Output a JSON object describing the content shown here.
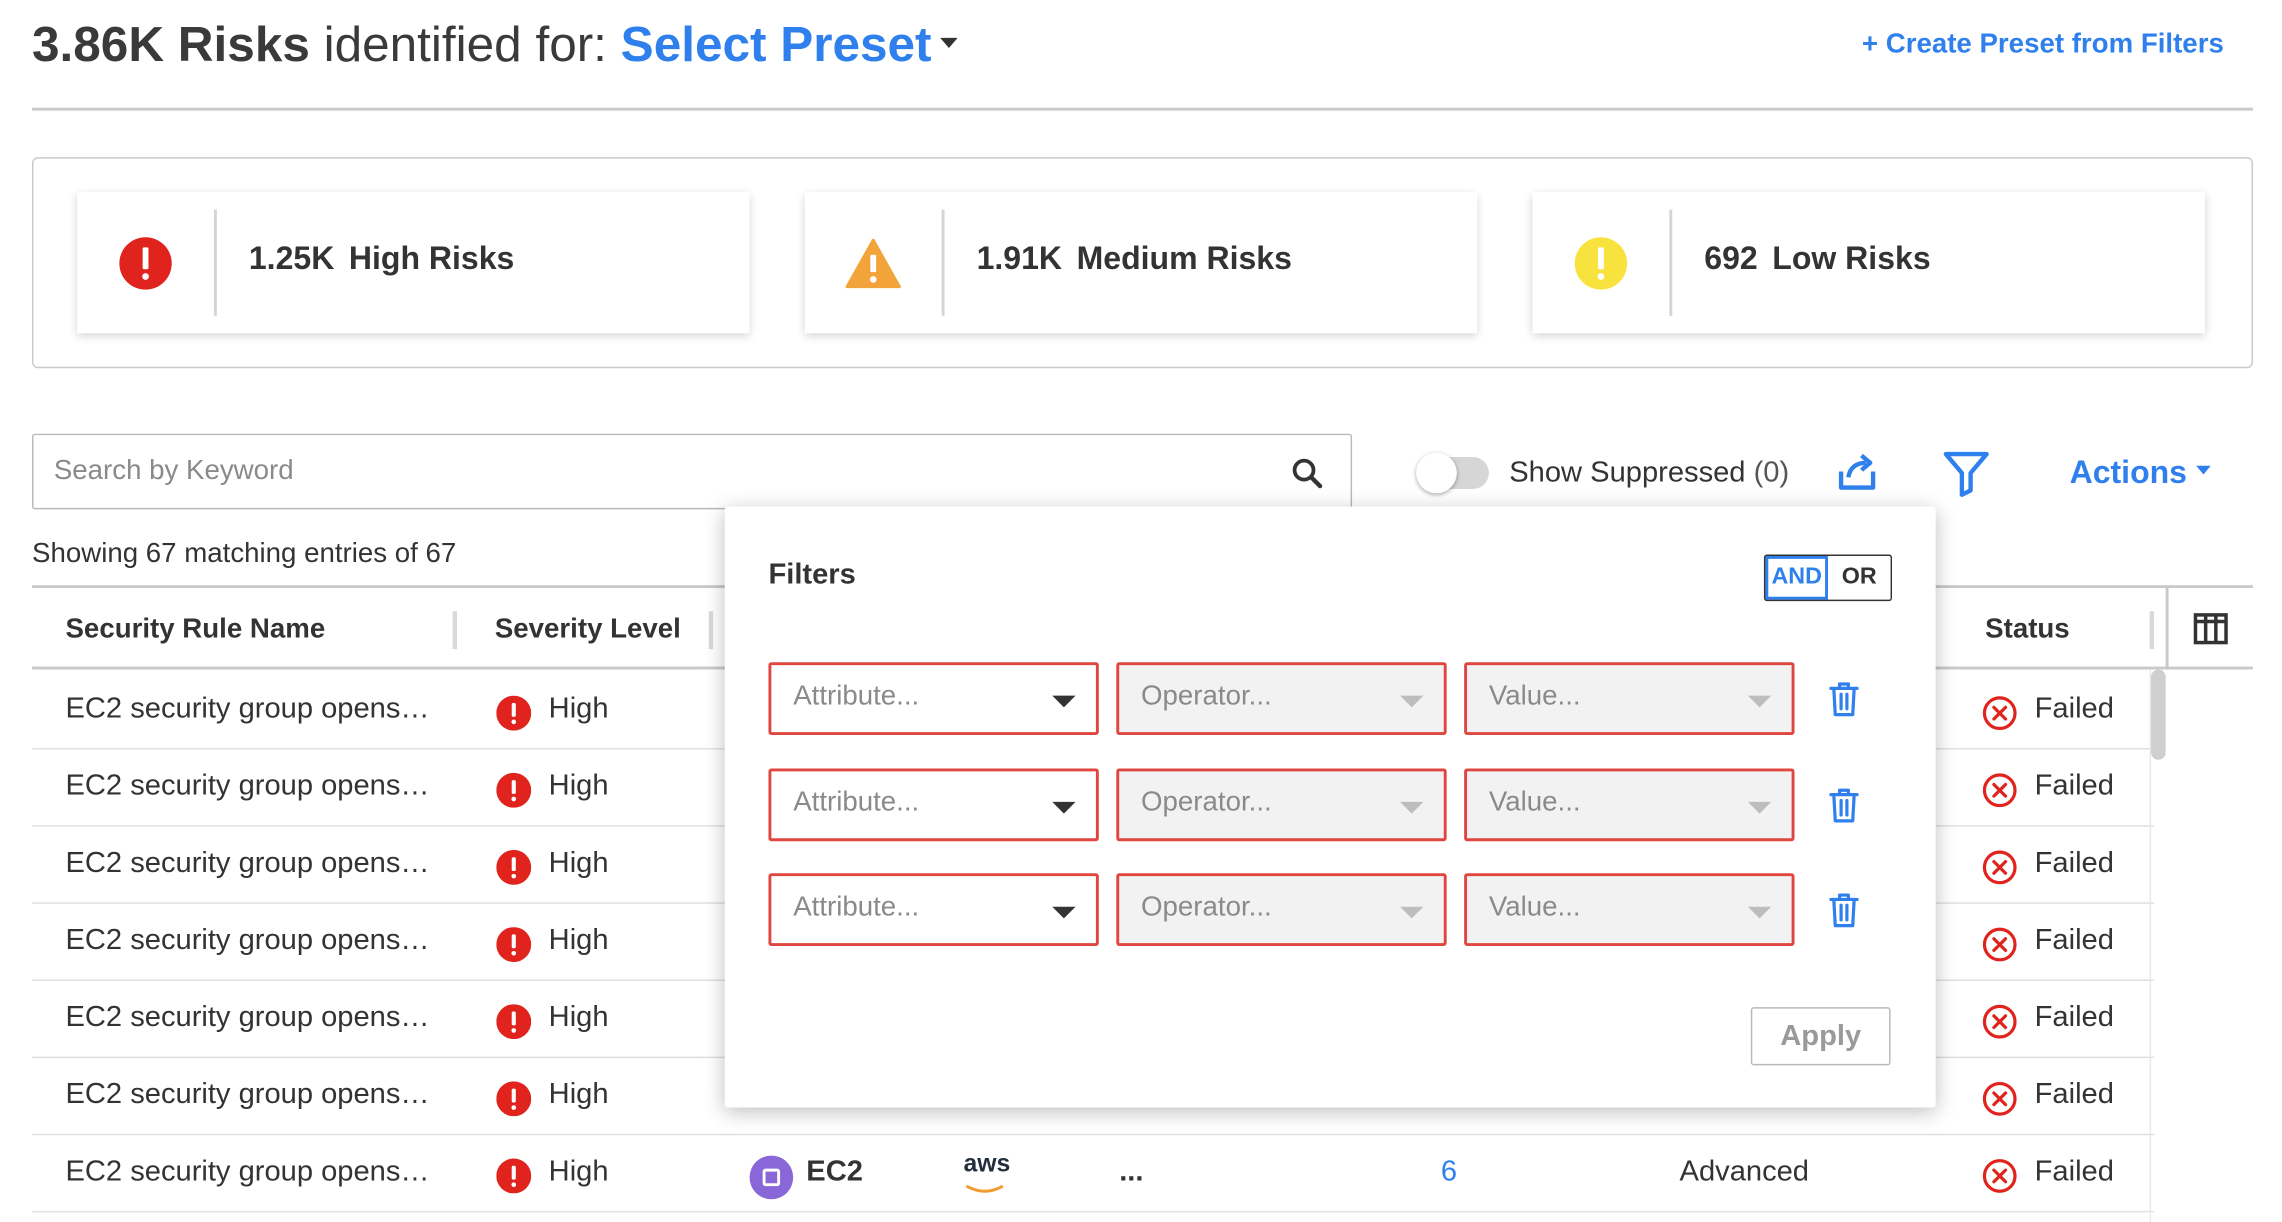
{
  "header": {
    "count": "3.86K Risks",
    "identified_text": " identified for: ",
    "preset_label": "Select Preset",
    "create_preset": "+ Create Preset from Filters"
  },
  "summary": {
    "high": {
      "count": "1.25K",
      "label": "High Risks",
      "color": "#e0231c"
    },
    "medium": {
      "count": "1.91K",
      "label": "Medium Risks",
      "color": "#f2a33a"
    },
    "low": {
      "count": "692",
      "label": "Low Risks",
      "color": "#f8e33e"
    }
  },
  "search": {
    "placeholder": "Search by Keyword",
    "icon": "search-icon"
  },
  "toolbar": {
    "suppressed_label": "Show Suppressed",
    "suppressed_count": "(0)",
    "share_icon": "share-icon",
    "filter_icon": "filter-icon",
    "actions_label": "Actions"
  },
  "showing_text": "Showing 67 matching entries of 67",
  "table": {
    "columns": [
      "Security Rule Name",
      "Severity Level",
      "Status"
    ],
    "rows": [
      {
        "name": "EC2 security group opens…",
        "severity": "High",
        "status": "Failed"
      },
      {
        "name": "EC2 security group opens…",
        "severity": "High",
        "status": "Failed"
      },
      {
        "name": "EC2 security group opens…",
        "severity": "High",
        "status": "Failed"
      },
      {
        "name": "EC2 security group opens…",
        "severity": "High",
        "status": "Failed"
      },
      {
        "name": "EC2 security group opens…",
        "severity": "High",
        "status": "Failed"
      },
      {
        "name": "EC2 security group opens…",
        "severity": "High",
        "status": "Failed"
      },
      {
        "name": "EC2 security group opens…",
        "severity": "High",
        "service": "EC2",
        "provider": "aws",
        "more": "...",
        "count": "6",
        "tier": "Advanced",
        "status": "Failed"
      }
    ]
  },
  "filters": {
    "title": "Filters",
    "and_label": "AND",
    "or_label": "OR",
    "attribute_placeholder": "Attribute...",
    "operator_placeholder": "Operator...",
    "value_placeholder": "Value...",
    "apply_label": "Apply"
  }
}
